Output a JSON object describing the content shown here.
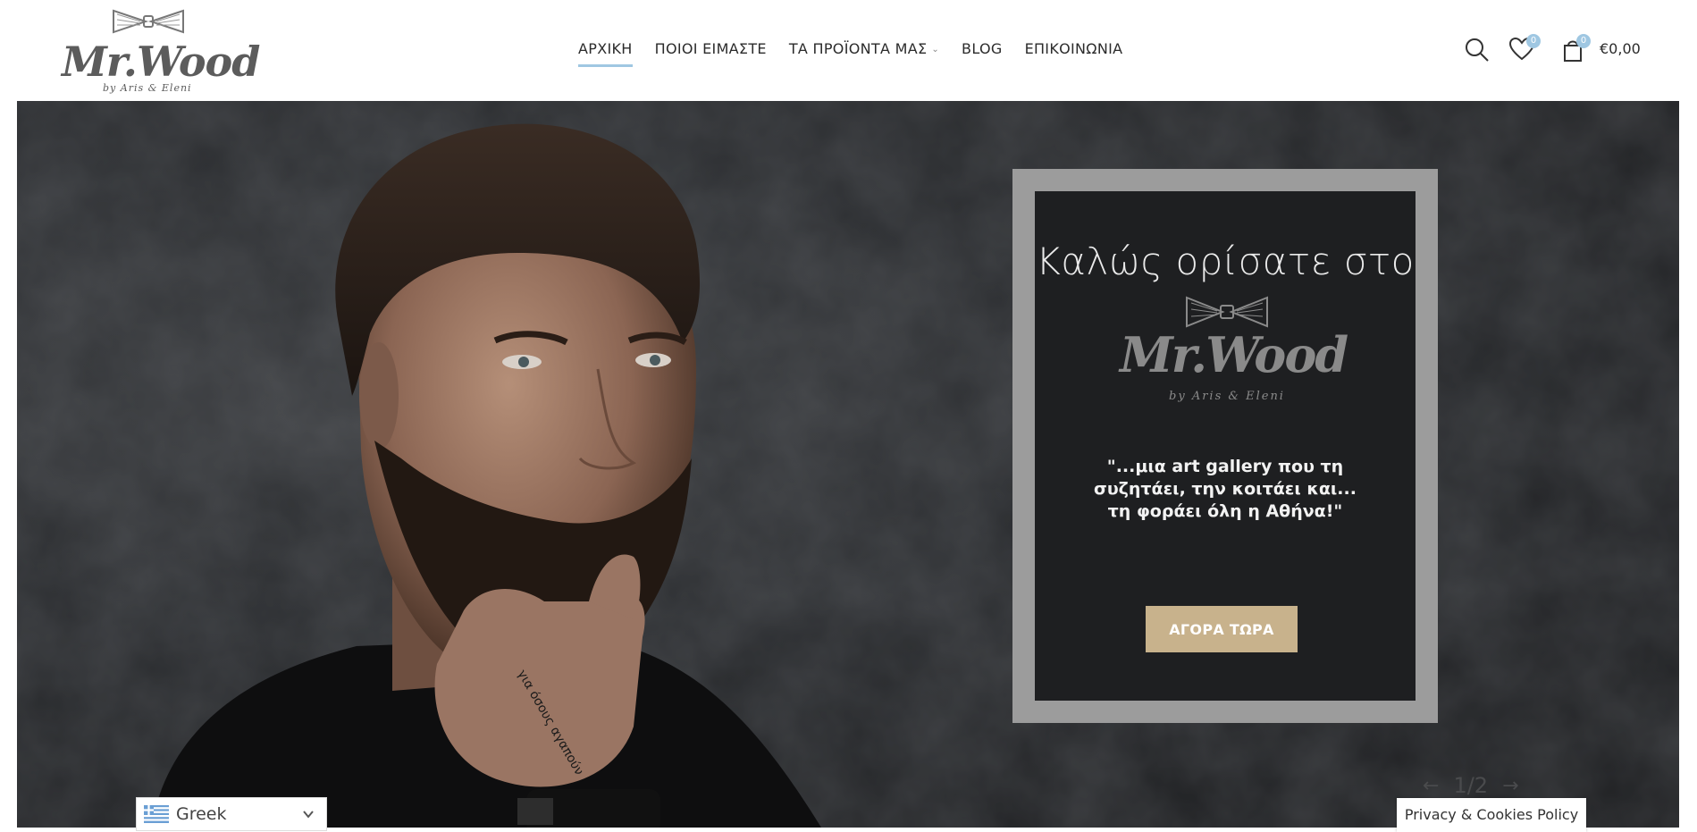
{
  "brand": {
    "name": "Mr.Wood",
    "sub": "by Aris & Eleni",
    "tm": "™"
  },
  "nav": {
    "items": [
      {
        "label": "ΑΡΧΙΚΗ"
      },
      {
        "label": "ΠΟΙΟΙ ΕΙΜΑΣΤΕ"
      },
      {
        "label": "ΤΑ ΠΡΟΪΟΝΤΑ ΜΑΣ"
      },
      {
        "label": "BLOG"
      },
      {
        "label": "ΕΠΙΚΟΙΝΩΝΙΑ"
      }
    ]
  },
  "header": {
    "wishlist_count": "0",
    "cart_count": "0",
    "cart_total": "€0,00"
  },
  "hero": {
    "welcome": "Καλώς ορίσατε στο",
    "quote_line1": "\"...μια art gallery που τη",
    "quote_line2": "συζητάει, την κοιτάει και...",
    "quote_line3": "τη φοράει όλη η Αθήνα!\"",
    "cta": "ΑΓΟΡΑ ΤΩΡΑ",
    "slide_counter": "1/2",
    "prev_arrow": "←",
    "next_arrow": "→"
  },
  "language": {
    "selected": "Greek"
  },
  "privacy": {
    "label": "Privacy & Cookies Policy"
  },
  "colors": {
    "accent": "#9fc7e2",
    "cta": "#c8b28c",
    "frame": "#9c9c9c"
  }
}
